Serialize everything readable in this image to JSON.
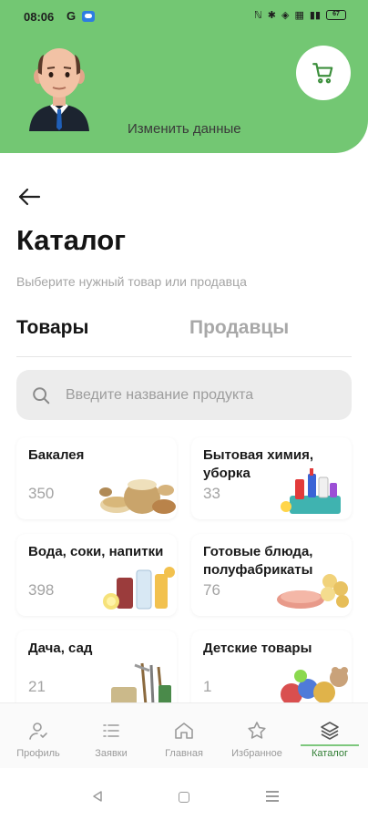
{
  "status_bar": {
    "time": "08:06",
    "g_label": "G",
    "battery": "67"
  },
  "header": {
    "edit_profile": "Изменить данные"
  },
  "page": {
    "title": "Каталог",
    "subtitle": "Выберите нужный товар или продавца"
  },
  "tabs": {
    "goods": "Товары",
    "sellers": "Продавцы"
  },
  "search": {
    "placeholder": "Введите название продукта",
    "value": ""
  },
  "categories": [
    {
      "name": "Бакалея",
      "count": "350",
      "icon": "grains-image"
    },
    {
      "name": "Бытовая химия, уборка",
      "count": "33",
      "icon": "cleaning-supplies-image"
    },
    {
      "name": "Вода, соки, напитки",
      "count": "398",
      "icon": "drinks-image"
    },
    {
      "name": "Готовые блюда, полуфабрикаты",
      "count": "76",
      "icon": "ready-meals-image"
    },
    {
      "name": "Дача, сад",
      "count": "21",
      "icon": "garden-tools-image"
    },
    {
      "name": "Детские товары",
      "count": "1",
      "icon": "toys-image"
    }
  ],
  "bottom_nav": [
    {
      "label": "Профиль",
      "icon": "profile-icon"
    },
    {
      "label": "Заявки",
      "icon": "list-icon"
    },
    {
      "label": "Главная",
      "icon": "home-icon"
    },
    {
      "label": "Избранное",
      "icon": "star-icon"
    },
    {
      "label": "Каталог",
      "icon": "layers-icon",
      "active": true
    }
  ],
  "colors": {
    "header_green": "#73c773",
    "active_nav": "#2f7d32"
  }
}
